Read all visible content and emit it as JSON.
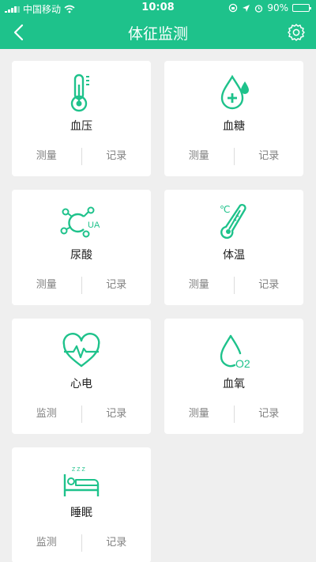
{
  "status": {
    "carrier": "中国移动",
    "time": "10:08",
    "battery": "90%",
    "battery_level": 0.9
  },
  "header": {
    "title": "体征监测"
  },
  "colors": {
    "accent": "#1ec28b"
  },
  "cards": [
    {
      "name": "血压",
      "icon": "thermometer-icon",
      "left_action": "测量",
      "right_action": "记录"
    },
    {
      "name": "血糖",
      "icon": "blood-drop-plus-icon",
      "left_action": "测量",
      "right_action": "记录"
    },
    {
      "name": "尿酸",
      "icon": "uric-acid-molecule-icon",
      "icon_text": "UA",
      "left_action": "测量",
      "right_action": "记录"
    },
    {
      "name": "体温",
      "icon": "body-temperature-thermometer-icon",
      "icon_text": "℃",
      "left_action": "测量",
      "right_action": "记录"
    },
    {
      "name": "心电",
      "icon": "heart-ecg-icon",
      "left_action": "监测",
      "right_action": "记录"
    },
    {
      "name": "血氧",
      "icon": "oxygen-drop-icon",
      "icon_text": "O2",
      "left_action": "测量",
      "right_action": "记录"
    },
    {
      "name": "睡眠",
      "icon": "sleep-bed-icon",
      "icon_text": "Z Z Z",
      "left_action": "监测",
      "right_action": "记录"
    }
  ]
}
